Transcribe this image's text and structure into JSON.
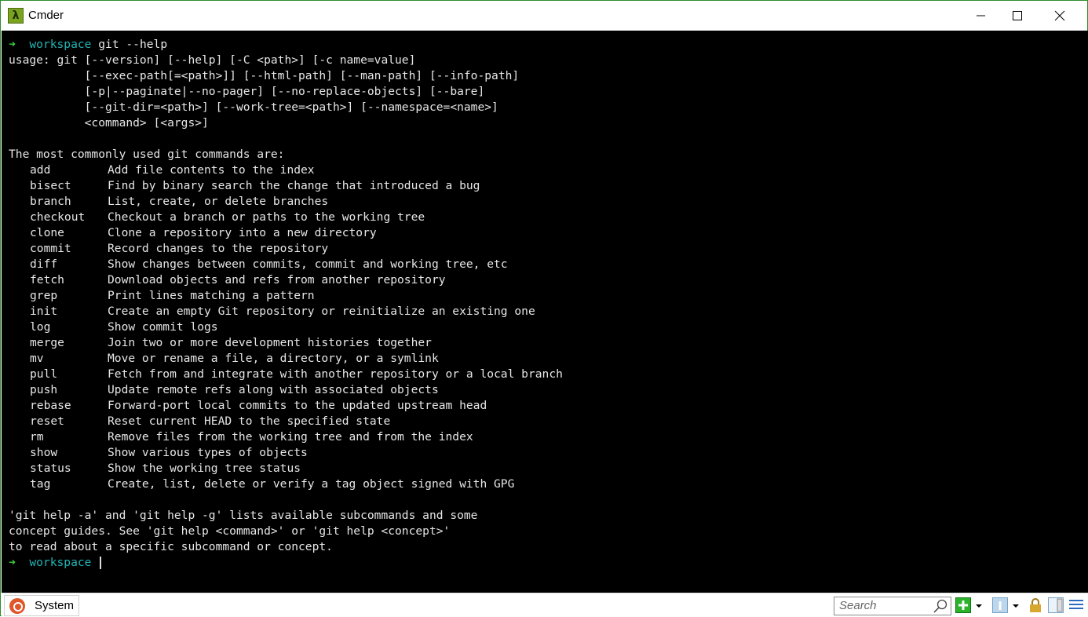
{
  "window": {
    "title": "Cmder",
    "icon": "lambda-icon",
    "icon_glyph": "λ",
    "minimize": "minimize-icon",
    "maximize": "maximize-icon",
    "close": "close-icon"
  },
  "terminal": {
    "prompt_arrow": "➜",
    "prompt_dir": "workspace",
    "command": "git --help",
    "usage_lines": [
      "usage: git [--version] [--help] [-C <path>] [-c name=value]",
      "           [--exec-path[=<path>]] [--html-path] [--man-path] [--info-path]",
      "           [-p|--paginate|--no-pager] [--no-replace-objects] [--bare]",
      "           [--git-dir=<path>] [--work-tree=<path>] [--namespace=<name>]",
      "           <command> [<args>]"
    ],
    "commands_header": "The most commonly used git commands are:",
    "commands": [
      {
        "name": "add",
        "desc": "Add file contents to the index"
      },
      {
        "name": "bisect",
        "desc": "Find by binary search the change that introduced a bug"
      },
      {
        "name": "branch",
        "desc": "List, create, or delete branches"
      },
      {
        "name": "checkout",
        "desc": "Checkout a branch or paths to the working tree"
      },
      {
        "name": "clone",
        "desc": "Clone a repository into a new directory"
      },
      {
        "name": "commit",
        "desc": "Record changes to the repository"
      },
      {
        "name": "diff",
        "desc": "Show changes between commits, commit and working tree, etc"
      },
      {
        "name": "fetch",
        "desc": "Download objects and refs from another repository"
      },
      {
        "name": "grep",
        "desc": "Print lines matching a pattern"
      },
      {
        "name": "init",
        "desc": "Create an empty Git repository or reinitialize an existing one"
      },
      {
        "name": "log",
        "desc": "Show commit logs"
      },
      {
        "name": "merge",
        "desc": "Join two or more development histories together"
      },
      {
        "name": "mv",
        "desc": "Move or rename a file, a directory, or a symlink"
      },
      {
        "name": "pull",
        "desc": "Fetch from and integrate with another repository or a local branch"
      },
      {
        "name": "push",
        "desc": "Update remote refs along with associated objects"
      },
      {
        "name": "rebase",
        "desc": "Forward-port local commits to the updated upstream head"
      },
      {
        "name": "reset",
        "desc": "Reset current HEAD to the specified state"
      },
      {
        "name": "rm",
        "desc": "Remove files from the working tree and from the index"
      },
      {
        "name": "show",
        "desc": "Show various types of objects"
      },
      {
        "name": "status",
        "desc": "Show the working tree status"
      },
      {
        "name": "tag",
        "desc": "Create, list, delete or verify a tag object signed with GPG"
      }
    ],
    "footer_lines": [
      "'git help -a' and 'git help -g' lists available subcommands and some",
      "concept guides. See 'git help <command>' or 'git help <concept>'",
      "to read about a specific subcommand or concept."
    ]
  },
  "statusbar": {
    "tab_label": "System",
    "tab_icon": "ubuntu-icon",
    "search_placeholder": "Search"
  },
  "colors": {
    "prompt_arrow": "#3bd13b",
    "prompt_dir": "#21b4b4",
    "frame": "#2e8b2e"
  }
}
